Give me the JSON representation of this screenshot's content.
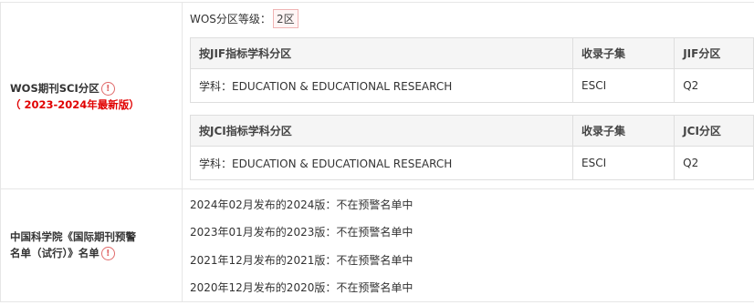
{
  "wos": {
    "label": "WOS期刊SCI分区",
    "sub_label": "（ 2023-2024年最新版）",
    "grade_label": "WOS分区等级：",
    "grade_value": "2区",
    "jif_table": {
      "headers": [
        "按JIF指标学科分区",
        "收录子集",
        "JIF分区"
      ],
      "row": [
        "学科：EDUCATION & EDUCATIONAL RESEARCH",
        "ESCI",
        "Q2"
      ]
    },
    "jci_table": {
      "headers": [
        "按JCI指标学科分区",
        "收录子集",
        "JCI分区"
      ],
      "row": [
        "学科：EDUCATION & EDUCATIONAL RESEARCH",
        "ESCI",
        "Q2"
      ]
    }
  },
  "cas": {
    "label_line1": "中国科学院《国际期刊预警",
    "label_line2": "名单（试行）》名单",
    "entries": [
      "2024年02月发布的2024版：不在预警名单中",
      "2023年01月发布的2023版：不在预警名单中",
      "2021年12月发布的2021版：不在预警名单中",
      "2020年12月发布的2020版：不在预警名单中"
    ]
  },
  "icons": {
    "warning": "!"
  },
  "colors": {
    "accent_red": "#e10000",
    "border": "#e6e6e6",
    "header_bg": "#f5f5f5"
  }
}
